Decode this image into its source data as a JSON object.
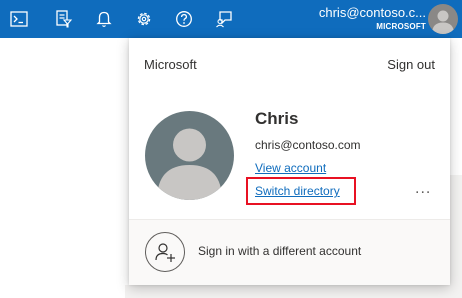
{
  "topbar": {
    "icons": [
      "cloud-shell-icon",
      "directory-filter-icon",
      "notifications-bell-icon",
      "settings-gear-icon",
      "help-question-icon",
      "feedback-icon"
    ],
    "account_email": "chris@contoso.c...",
    "account_directory": "MICROSOFT",
    "background_color": "#0f6cbd"
  },
  "account_panel": {
    "company": "Microsoft",
    "sign_out_label": "Sign out",
    "user_name": "Chris",
    "user_email": "chris@contoso.com",
    "view_account_label": "View account",
    "switch_directory_label": "Switch directory",
    "more_label": "...",
    "sign_in_other_label": "Sign in with a different account",
    "link_color": "#0f6cbd",
    "highlight_color": "#e81123"
  }
}
